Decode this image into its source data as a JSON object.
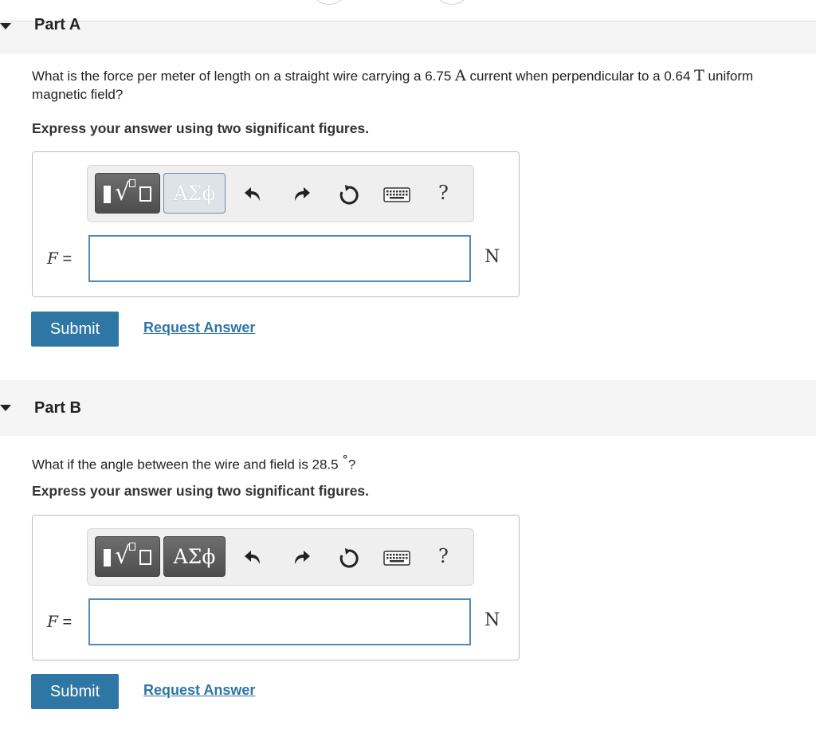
{
  "parts": [
    {
      "title": "Part A",
      "question_pre": "What is the force per meter of length on a straight wire carrying a 6.75 ",
      "question_unit1": "A",
      "question_mid": " current when perpendicular to a 0.64 ",
      "question_unit2": "T",
      "question_post": " uniform magnetic field?",
      "instruction": "Express your answer using two significant figures.",
      "templates_label": "ΑΣϕ",
      "help_label": "?",
      "variable": "F",
      "equals": " =",
      "input_value": "",
      "unit": "N",
      "submit_label": "Submit",
      "request_label": "Request Answer"
    },
    {
      "title": "Part B",
      "question_pre": "What if the angle between the wire and field is 28.5 ",
      "question_unit1": "°",
      "question_post": "?",
      "instruction": "Express your answer using two significant figures.",
      "templates_label": "ΑΣϕ",
      "help_label": "?",
      "variable": "F",
      "equals": " =",
      "input_value": "",
      "unit": "N",
      "submit_label": "Submit",
      "request_label": "Request Answer"
    }
  ]
}
